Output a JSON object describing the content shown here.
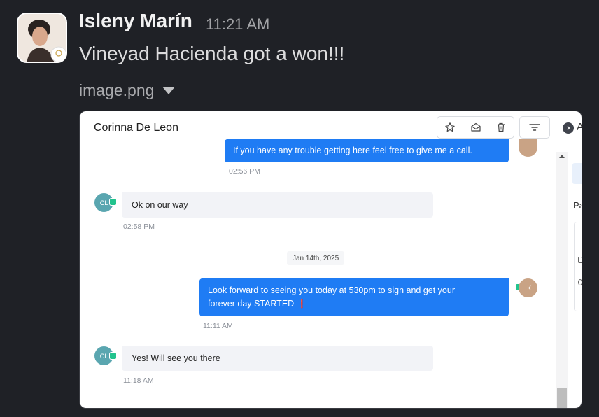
{
  "message": {
    "author": "Isleny Marín",
    "time": "11:21 AM",
    "text": "Vineyad Hacienda got a won!!!",
    "attachment": {
      "filename": "image.png",
      "toggle_icon": "caret-down-icon"
    }
  },
  "screenshot": {
    "header": {
      "contact_name": "Corinna De Leon",
      "actions": [
        "star-icon",
        "mail-open-icon",
        "trash-icon",
        "filter-icon"
      ],
      "side_letter": "A"
    },
    "side_panel": {
      "partial_label": "Pa"
    },
    "conversation": [
      {
        "direction": "outbound",
        "text": "If you have any trouble getting here feel free to give me a call.",
        "time": "02:56 PM"
      },
      {
        "direction": "inbound",
        "avatar": "CL",
        "text": "Ok on our way",
        "time": "02:58 PM"
      },
      {
        "type": "date_divider",
        "text": "Jan 14th, 2025"
      },
      {
        "direction": "outbound",
        "avatar": "K.",
        "lines": [
          "Look forward to seeing you today at 530pm to sign and get your",
          "forever day STARTED ❗"
        ],
        "time": "11:11 AM"
      },
      {
        "direction": "inbound",
        "avatar": "CL",
        "text": "Yes! Will see you there",
        "time": "11:18 AM"
      }
    ]
  },
  "colors": {
    "background": "#1f2126",
    "outbound_bubble": "#1f7cf4",
    "inbound_bubble": "#f2f3f7",
    "channel_badge": "#22c38e"
  }
}
